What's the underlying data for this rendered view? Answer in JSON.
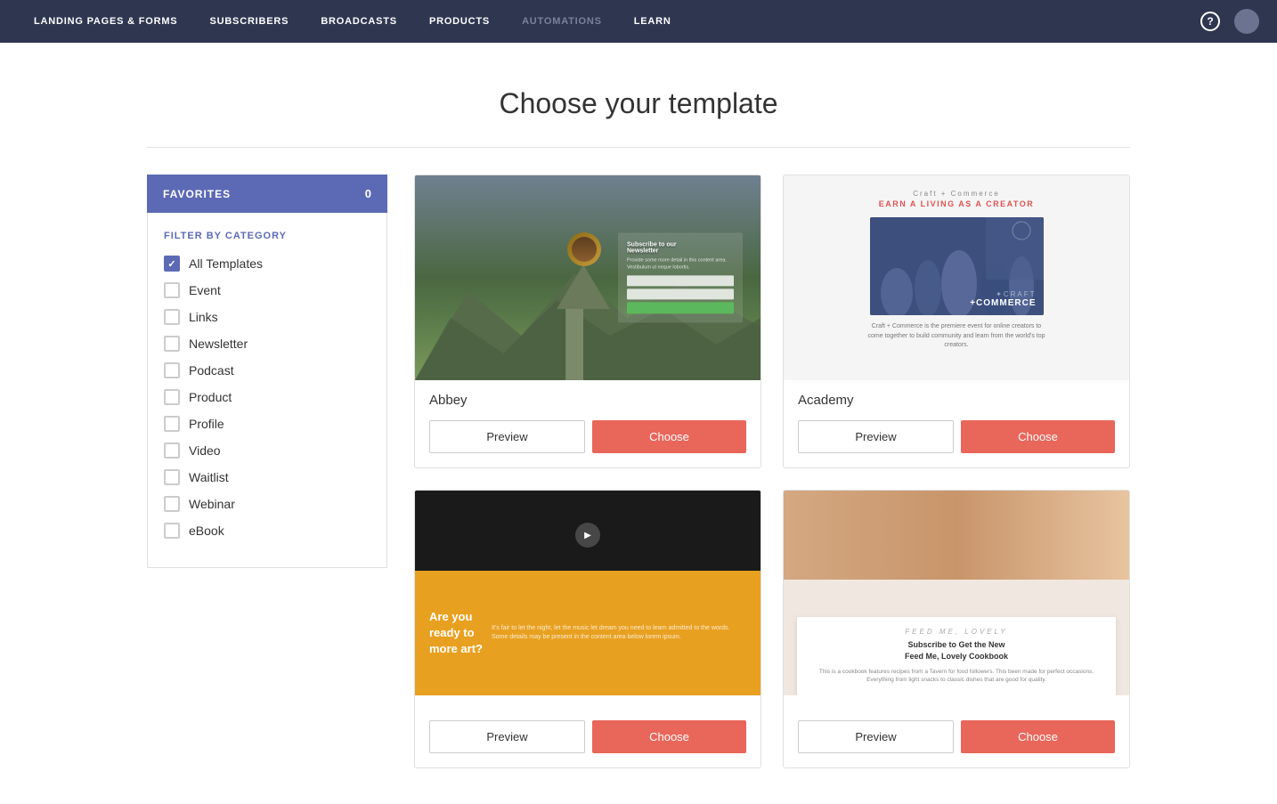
{
  "nav": {
    "items": [
      {
        "label": "LANDING PAGES & FORMS",
        "key": "landing-pages",
        "dimmed": false
      },
      {
        "label": "SUBSCRIBERS",
        "key": "subscribers",
        "dimmed": false
      },
      {
        "label": "BROADCASTS",
        "key": "broadcasts",
        "dimmed": false
      },
      {
        "label": "PRODUCTS",
        "key": "products",
        "dimmed": false
      },
      {
        "label": "AUTOMATIONS",
        "key": "automations",
        "dimmed": true
      },
      {
        "label": "LEARN",
        "key": "learn",
        "dimmed": false
      }
    ],
    "help_label": "?",
    "help_icon": "question-icon"
  },
  "page": {
    "title": "Choose your template"
  },
  "sidebar": {
    "favorites_label": "FAVORITES",
    "favorites_count": "0",
    "filter_title": "FILTER BY CATEGORY",
    "categories": [
      {
        "label": "All Templates",
        "checked": true
      },
      {
        "label": "Event",
        "checked": false
      },
      {
        "label": "Links",
        "checked": false
      },
      {
        "label": "Newsletter",
        "checked": false
      },
      {
        "label": "Podcast",
        "checked": false
      },
      {
        "label": "Product",
        "checked": false
      },
      {
        "label": "Profile",
        "checked": false
      },
      {
        "label": "Video",
        "checked": false
      },
      {
        "label": "Waitlist",
        "checked": false
      },
      {
        "label": "Webinar",
        "checked": false
      },
      {
        "label": "eBook",
        "checked": false
      }
    ]
  },
  "templates": [
    {
      "name": "Abbey",
      "preview_label": "Preview",
      "choose_label": "Choose",
      "type": "abbey"
    },
    {
      "name": "Academy",
      "preview_label": "Preview",
      "choose_label": "Choose",
      "type": "academy"
    },
    {
      "name": "",
      "preview_label": "Preview",
      "choose_label": "Choose",
      "type": "art"
    },
    {
      "name": "",
      "preview_label": "Preview",
      "choose_label": "Choose",
      "type": "food"
    }
  ]
}
